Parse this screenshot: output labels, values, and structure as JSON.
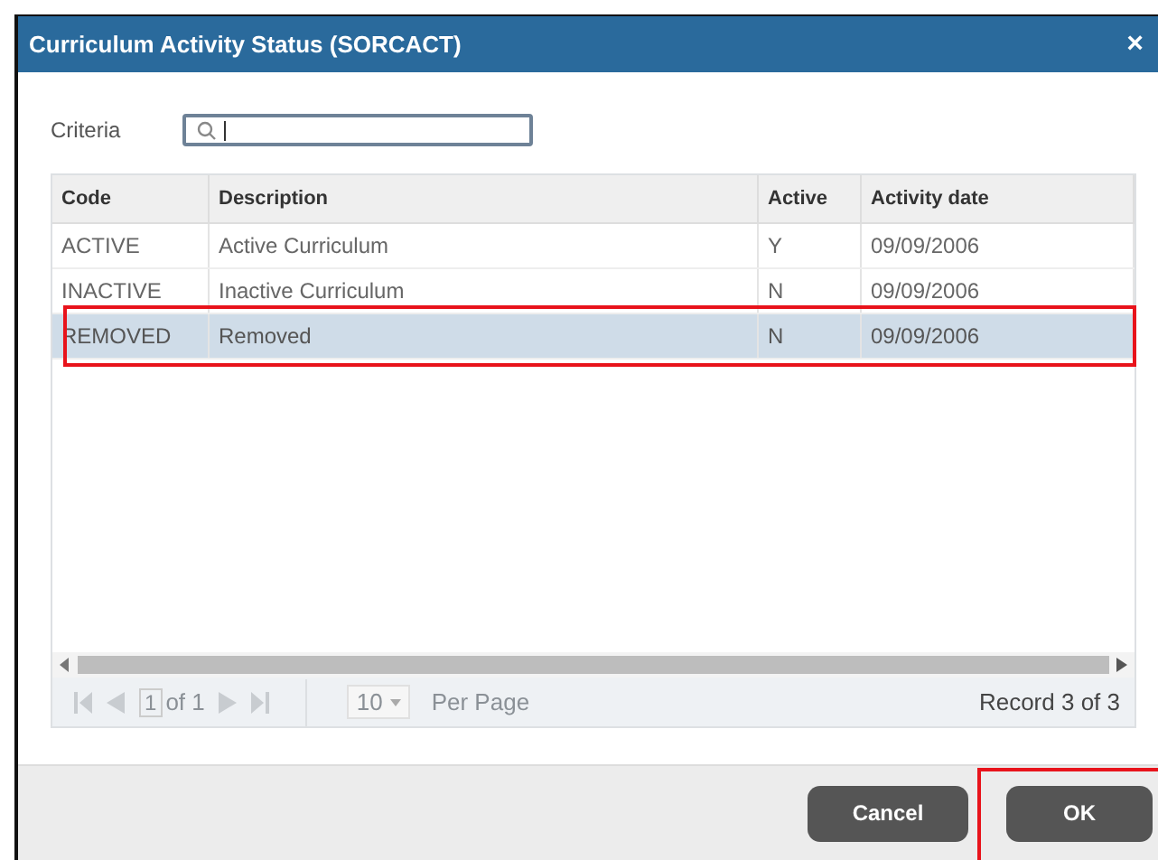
{
  "window": {
    "title": "Curriculum Activity Status (SORCACT)",
    "close": "×"
  },
  "criteria": {
    "label": "Criteria"
  },
  "table": {
    "columns": [
      "Code",
      "Description",
      "Active",
      "Activity date"
    ],
    "rows": [
      {
        "cells": [
          "ACTIVE",
          "Active Curriculum",
          "Y",
          "09/09/2006"
        ],
        "selected": false,
        "highlighted": false
      },
      {
        "cells": [
          "INACTIVE",
          "Inactive Curriculum",
          "N",
          "09/09/2006"
        ],
        "selected": false,
        "highlighted": false
      },
      {
        "cells": [
          "REMOVED",
          "Removed",
          "N",
          "09/09/2006"
        ],
        "selected": true,
        "highlighted": true
      }
    ]
  },
  "pager": {
    "page": "1",
    "of": "of 1",
    "per_page": "10",
    "per_page_label": "Per Page",
    "record": "Record 3 of 3"
  },
  "buttons": [
    {
      "label": "Cancel",
      "highlighted": false
    },
    {
      "label": "OK",
      "highlighted": true
    }
  ]
}
